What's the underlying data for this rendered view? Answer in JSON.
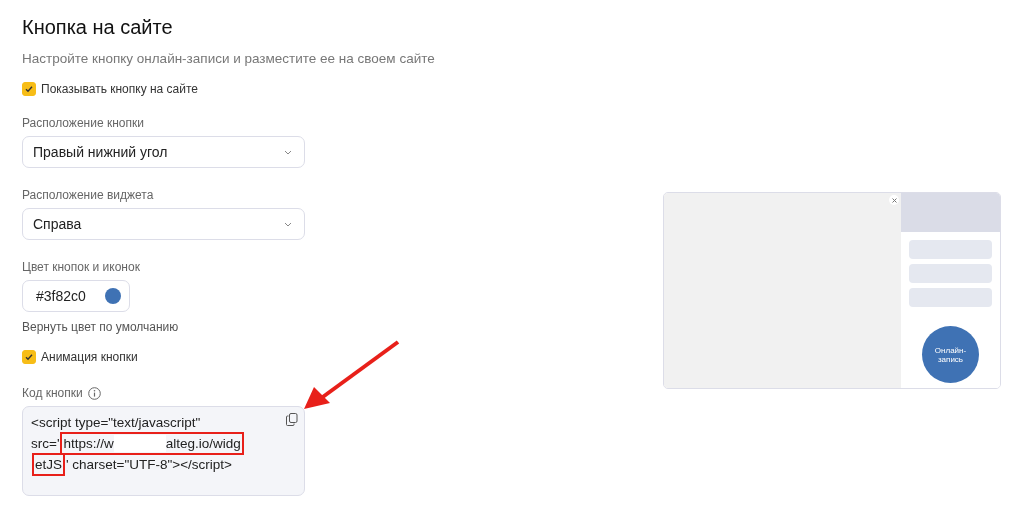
{
  "title": "Кнопка на сайте",
  "subtitle": "Настройте кнопку онлайн-записи и разместите ее на своем сайте",
  "show_button": {
    "label": "Показывать кнопку на сайте",
    "checked": true
  },
  "button_position": {
    "label": "Расположение кнопки",
    "value": "Правый нижний угол"
  },
  "widget_position": {
    "label": "Расположение виджета",
    "value": "Справа"
  },
  "color_field": {
    "label": "Цвет кнопок и иконок",
    "value": "#3f82c0",
    "color": "#3f72b4"
  },
  "reset_color": "Вернуть цвет по умолчанию",
  "animation": {
    "label": "Анимация кнопки",
    "checked": true
  },
  "code": {
    "label": "Код кнопки",
    "lines": [
      [
        {
          "highlighted": false,
          "parts": [
            {
              "kind": "text",
              "text": "<script type=\"text/javascript\""
            }
          ]
        }
      ],
      [
        {
          "highlighted": false,
          "parts": [
            {
              "kind": "text",
              "text": "src='"
            }
          ]
        },
        {
          "highlighted": true,
          "parts": [
            {
              "kind": "text",
              "text": "https://w"
            },
            {
              "kind": "redaction"
            },
            {
              "kind": "text",
              "text": "alteg.io/widg"
            }
          ]
        }
      ],
      [
        {
          "highlighted": true,
          "parts": [
            {
              "kind": "text",
              "text": "etJS"
            }
          ]
        },
        {
          "highlighted": false,
          "parts": [
            {
              "kind": "text",
              "text": "' charset=\"UTF-8\"></script>"
            }
          ]
        }
      ]
    ]
  },
  "preview": {
    "button": "Онлайн-запись"
  }
}
